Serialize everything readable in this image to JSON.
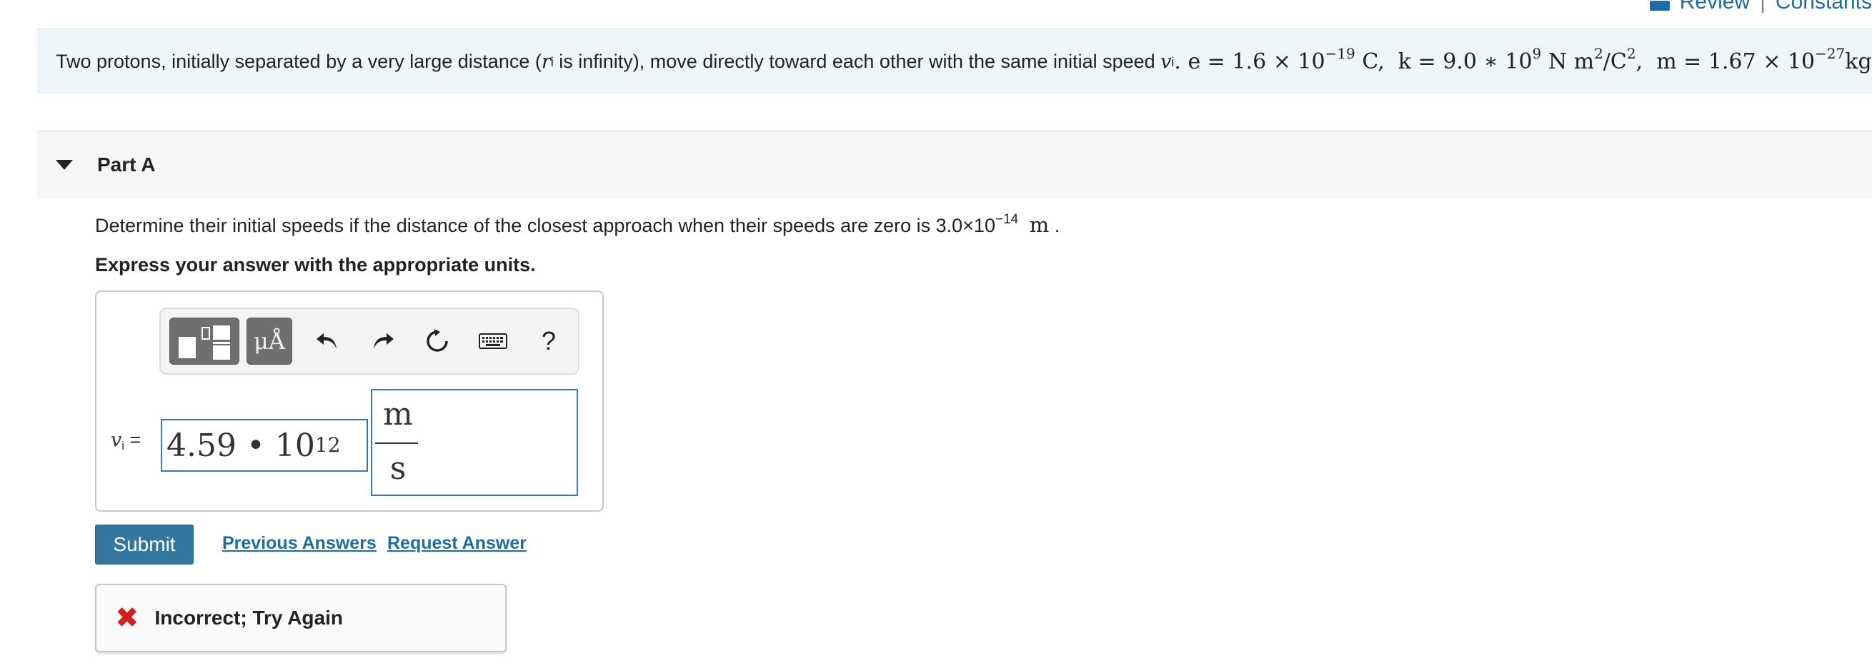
{
  "top_links": {
    "review": "Review",
    "separator": "|",
    "constants": "Constants"
  },
  "statement": {
    "text_before": "Two protons, initially separated by a very large distance (",
    "r_var": "r",
    "r_sub": "i",
    "text_mid": " is infinity), move directly toward each other with the same initial speed ",
    "v_var": "v",
    "v_sub": "i",
    "e_expr": ". e = 1.6 × 10",
    "e_exp": "−19",
    "k_expr": " C,  k = 9.0 ∗ 10",
    "k_exp": "9",
    "k_units": " N m",
    "k_units_exp": "2",
    "k_units_2": "/C",
    "k_units_2_exp": "2",
    "m_expr": ",  m = 1.67 × 10",
    "m_exp": "−27",
    "m_units": "kg."
  },
  "part": {
    "title": "Part A"
  },
  "question": {
    "text": "Determine their initial speeds if the distance of the closest approach when their speeds are zero is 3.0×10",
    "exp": "−14",
    "unit": "m",
    "end": "."
  },
  "instruction": "Express your answer with the appropriate units.",
  "toolbar": {
    "units_label": "μÅ",
    "undo_icon": "undo-icon",
    "redo_icon": "redo-icon",
    "reset_icon": "reset-icon",
    "keyboard_icon": "keyboard-icon",
    "help_label": "?"
  },
  "answer": {
    "var": "v",
    "var_sub": "i",
    "equals": " =",
    "value_mantissa": "4.59 • 10",
    "value_exp": "12",
    "unit_numerator": "m",
    "unit_denominator": "s"
  },
  "actions": {
    "submit": "Submit",
    "previous_answers": "Previous Answers",
    "request_answer": "Request Answer"
  },
  "feedback": {
    "icon": "✖",
    "text": "Incorrect; Try Again"
  },
  "colors": {
    "accent": "#3376a0",
    "link": "#1b6ea3",
    "error": "#d0211f",
    "band": "#eef6f7"
  }
}
